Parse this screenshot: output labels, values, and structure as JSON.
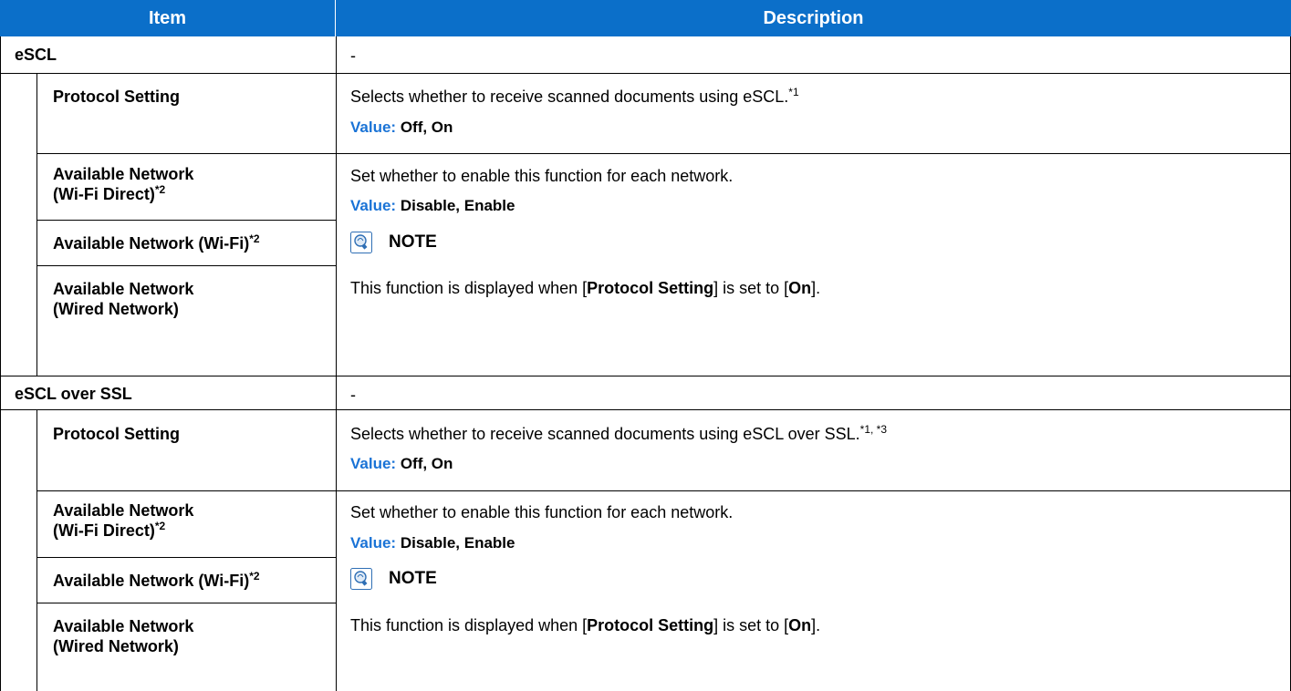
{
  "header": {
    "item": "Item",
    "description": "Description"
  },
  "sections": [
    {
      "title": "eSCL",
      "dash": "-",
      "protocol_setting": {
        "label": "Protocol Setting",
        "desc": "Selects whether to receive scanned documents using eSCL.",
        "desc_sup": "*1",
        "value_label": "Value:",
        "value": " Off, On"
      },
      "avail_wifi_direct": {
        "label_line1": "Available Network",
        "label_line2": "(Wi-Fi Direct)",
        "sup": "*2"
      },
      "avail_wifi": {
        "label": "Available Network (Wi-Fi)",
        "sup": "*2"
      },
      "avail_wired": {
        "label_line1": "Available Network",
        "label_line2": "(Wired Network)"
      },
      "network_desc": "Set whether to enable this function for each network.",
      "network_value_label": "Value:",
      "network_value": " Disable, Enable",
      "note_title": "NOTE",
      "note_text": {
        "p1": "This function is displayed when [",
        "b1": "Protocol Setting",
        "p2": "] is set to [",
        "b2": "On",
        "p3": "]."
      }
    },
    {
      "title": "eSCL over SSL",
      "dash": "-",
      "protocol_setting": {
        "label": "Protocol Setting",
        "desc": "Selects whether to receive scanned documents using eSCL over SSL.",
        "desc_sup": "*1, *3",
        "value_label": "Value:",
        "value": " Off, On"
      },
      "avail_wifi_direct": {
        "label_line1": "Available Network",
        "label_line2": "(Wi-Fi Direct)",
        "sup": "*2"
      },
      "avail_wifi": {
        "label": "Available Network (Wi-Fi)",
        "sup": "*2"
      },
      "avail_wired": {
        "label_line1": "Available Network",
        "label_line2": "(Wired Network)"
      },
      "network_desc": "Set whether to enable this function for each network.",
      "network_value_label": "Value:",
      "network_value": " Disable, Enable",
      "note_title": "NOTE",
      "note_text": {
        "p1": "This function is displayed when [",
        "b1": "Protocol Setting",
        "p2": "] is set to [",
        "b2": "On",
        "p3": "]."
      }
    }
  ],
  "colors": {
    "header_bg": "#0b6fc9",
    "value_label": "#1a73d6"
  },
  "icons": {
    "note": "note-lightbulb-icon"
  }
}
